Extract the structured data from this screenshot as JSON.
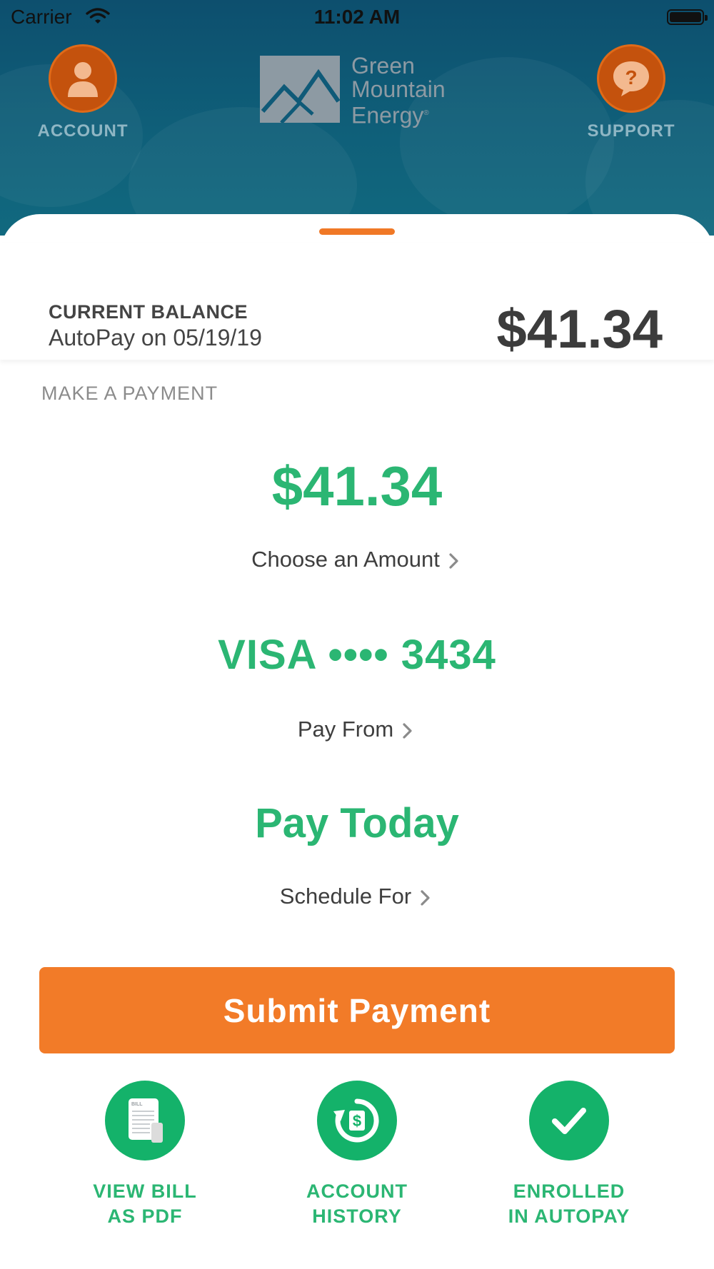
{
  "status_bar": {
    "carrier": "Carrier",
    "time": "11:02 AM"
  },
  "header": {
    "account_label": "ACCOUNT",
    "support_label": "SUPPORT",
    "logo": {
      "line1": "Green",
      "line2": "Mountain",
      "line3": "Energy",
      "mark": "®"
    }
  },
  "balance": {
    "label": "CURRENT BALANCE",
    "autopay": "AutoPay on 05/19/19",
    "amount": "$41.34"
  },
  "payment": {
    "section_title": "MAKE A PAYMENT",
    "amount": "$41.34",
    "choose_amount": "Choose an Amount",
    "card": "VISA •••• 3434",
    "pay_from": "Pay From",
    "date": "Pay Today",
    "schedule_for": "Schedule For",
    "submit": "Submit Payment"
  },
  "actions": [
    {
      "line1": "VIEW BILL",
      "line2": "AS PDF",
      "icon": "bill-document-icon",
      "bill_text": "BILL"
    },
    {
      "line1": "ACCOUNT",
      "line2": "HISTORY",
      "icon": "history-dollar-icon"
    },
    {
      "line1": "ENROLLED",
      "line2": "IN AUTOPAY",
      "icon": "checkmark-icon"
    }
  ],
  "colors": {
    "header_bg": "#0f5a78",
    "accent_orange": "#f27b28",
    "green": "#2bb673",
    "icon_green": "#14b26a"
  }
}
